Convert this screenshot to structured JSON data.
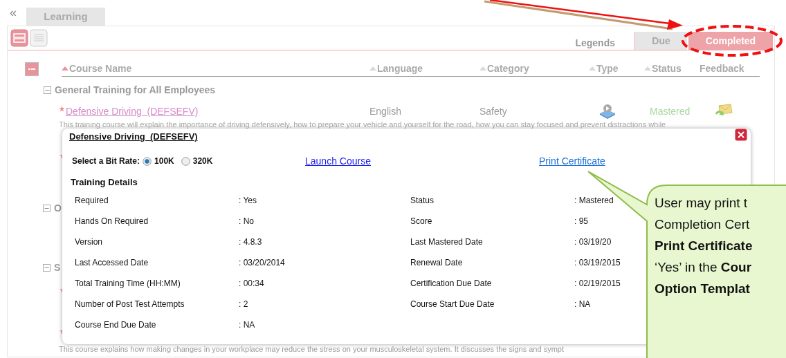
{
  "nav": {
    "collapse": "«",
    "tabs": [
      {
        "label": "Learning",
        "selected": true
      }
    ]
  },
  "legend": {
    "label": "Legends",
    "tabs": [
      {
        "label": "Due",
        "selected": false
      },
      {
        "label": "Completed",
        "selected": true
      }
    ]
  },
  "columns": [
    {
      "label": "Course Name",
      "sortable": true,
      "sorted": true
    },
    {
      "label": "Language",
      "sortable": true,
      "sorted": false
    },
    {
      "label": "Category",
      "sortable": true,
      "sorted": false
    },
    {
      "label": "Type",
      "sortable": true,
      "sorted": false
    },
    {
      "label": "Status",
      "sortable": true,
      "sorted": false
    },
    {
      "label": "Feedback",
      "sortable": false
    }
  ],
  "groups": [
    {
      "name": "General Training for All Employees",
      "expanded": true,
      "courses": [
        {
          "title": "Defensive Driving  (DEFSEFV)",
          "required": true,
          "language": "English",
          "category": "Safety",
          "status": "Mastered",
          "description": "This training course will explain the importance of driving defensively, how to prepare your vehicle and yourself for the road, how you can stay focused and prevent distractions while"
        }
      ]
    },
    {
      "name": "O",
      "expanded": true
    },
    {
      "name": "S",
      "expanded": true
    }
  ],
  "hidden_rows_tail": {
    "description": "This course explains how making changes in your workplace may reduce the stress on your musculoskeletal system. It discusses the signs and sympt"
  },
  "popup": {
    "title": "Defensive Driving  (DEFSEFV)",
    "bit_rate_label": "Select a Bit Rate:",
    "bit_rates": [
      {
        "label": "100K",
        "selected": true
      },
      {
        "label": "320K",
        "selected": false
      }
    ],
    "launch_link": "Launch Course",
    "print_link": "Print Certificate",
    "details_heading": "Training Details",
    "details_left": [
      {
        "label": "Required",
        "value": ": Yes"
      },
      {
        "label": "Hands On Required",
        "value": ": No"
      },
      {
        "label": "Version",
        "value": ": 4.8.3"
      },
      {
        "label": "Last Accessed Date",
        "value": ": 03/20/2014"
      },
      {
        "label": "Total Training Time (HH:MM)",
        "value": ": 00:34"
      },
      {
        "label": "Number of Post Test Attempts",
        "value": ": 2"
      },
      {
        "label": "Course End Due Date",
        "value": ": NA"
      }
    ],
    "details_right": [
      {
        "label": "Status",
        "value": ": Mastered"
      },
      {
        "label": "Score",
        "value": ": 95"
      },
      {
        "label": "Last Mastered Date",
        "value": ": 03/19/20"
      },
      {
        "label": "Renewal Date",
        "value": ": 03/19/2015"
      },
      {
        "label": "Certification Due Date",
        "value": ": 02/19/2015"
      },
      {
        "label": "Course Start Due Date",
        "value": ": NA"
      }
    ]
  },
  "callout": {
    "lines": [
      "User may print t",
      "Completion Cert",
      "**Print Certificate**",
      "‘Yes’ in the **Cour**",
      "**Option Templat**"
    ]
  }
}
